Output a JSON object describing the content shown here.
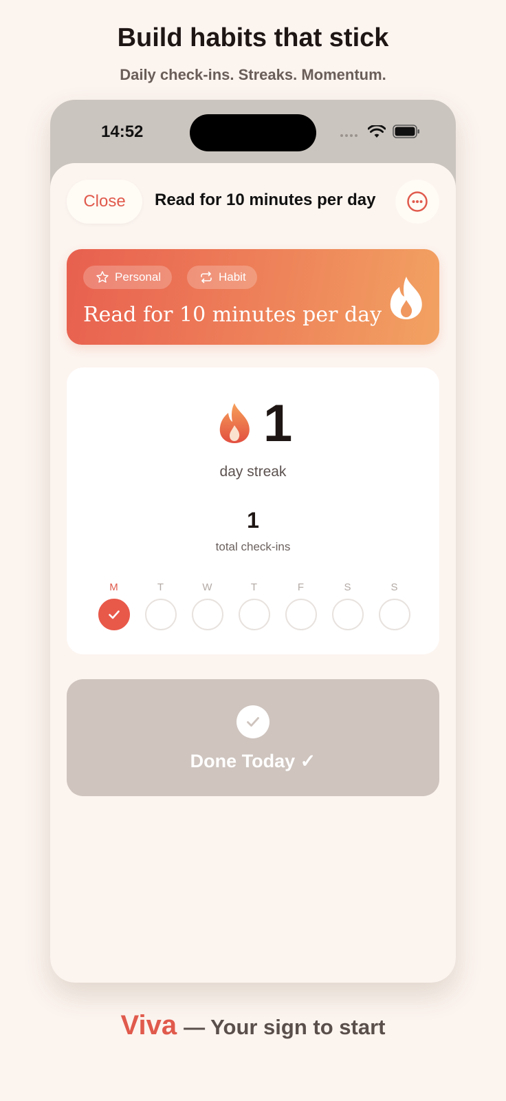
{
  "promo": {
    "headline": "Build habits that stick",
    "subline": "Daily check-ins. Streaks. Momentum."
  },
  "status_bar": {
    "time": "14:52"
  },
  "sheet": {
    "close_label": "Close",
    "title": "Read for 10 minutes per day"
  },
  "banner": {
    "chips": [
      {
        "label": "Personal",
        "icon": "star-icon"
      },
      {
        "label": "Habit",
        "icon": "repeat-icon"
      }
    ],
    "title": "Read for 10 minutes per day",
    "icon": "flame-icon"
  },
  "stats": {
    "streak_value": "1",
    "streak_label": "day streak",
    "checkins_value": "1",
    "checkins_label": "total check-ins",
    "week": [
      {
        "letter": "M",
        "done": true
      },
      {
        "letter": "T",
        "done": false
      },
      {
        "letter": "W",
        "done": false
      },
      {
        "letter": "T",
        "done": false
      },
      {
        "letter": "F",
        "done": false
      },
      {
        "letter": "S",
        "done": false
      },
      {
        "letter": "S",
        "done": false
      }
    ]
  },
  "done_button": {
    "label": "Done Today ✓"
  },
  "footer": {
    "brand": "Viva",
    "tagline": "— Your sign to start"
  },
  "colors": {
    "accent": "#e05a4c",
    "background": "#fcf4ef",
    "banner_start": "#e8604f",
    "banner_end": "#f2a262",
    "done_button": "#cfc4be"
  }
}
